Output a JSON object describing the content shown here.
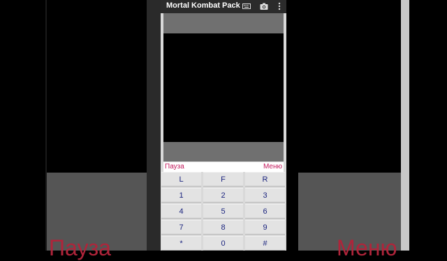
{
  "background": {
    "left_label": "Пауза",
    "right_label": "Меню"
  },
  "titlebar": {
    "title": "Mortal Kombat Pack",
    "icons": [
      "keyboard-icon",
      "camera-icon",
      "more-vert-icon"
    ]
  },
  "softkeys": {
    "left": "Пауза",
    "right": "Меню"
  },
  "keypad": {
    "rows": [
      [
        "L",
        "F",
        "R"
      ],
      [
        "1",
        "2",
        "3"
      ],
      [
        "4",
        "5",
        "6"
      ],
      [
        "7",
        "8",
        "9"
      ],
      [
        "*",
        "0",
        "#"
      ]
    ]
  },
  "colors": {
    "softkey_text": "#c2185b",
    "key_text": "#1a237e"
  }
}
